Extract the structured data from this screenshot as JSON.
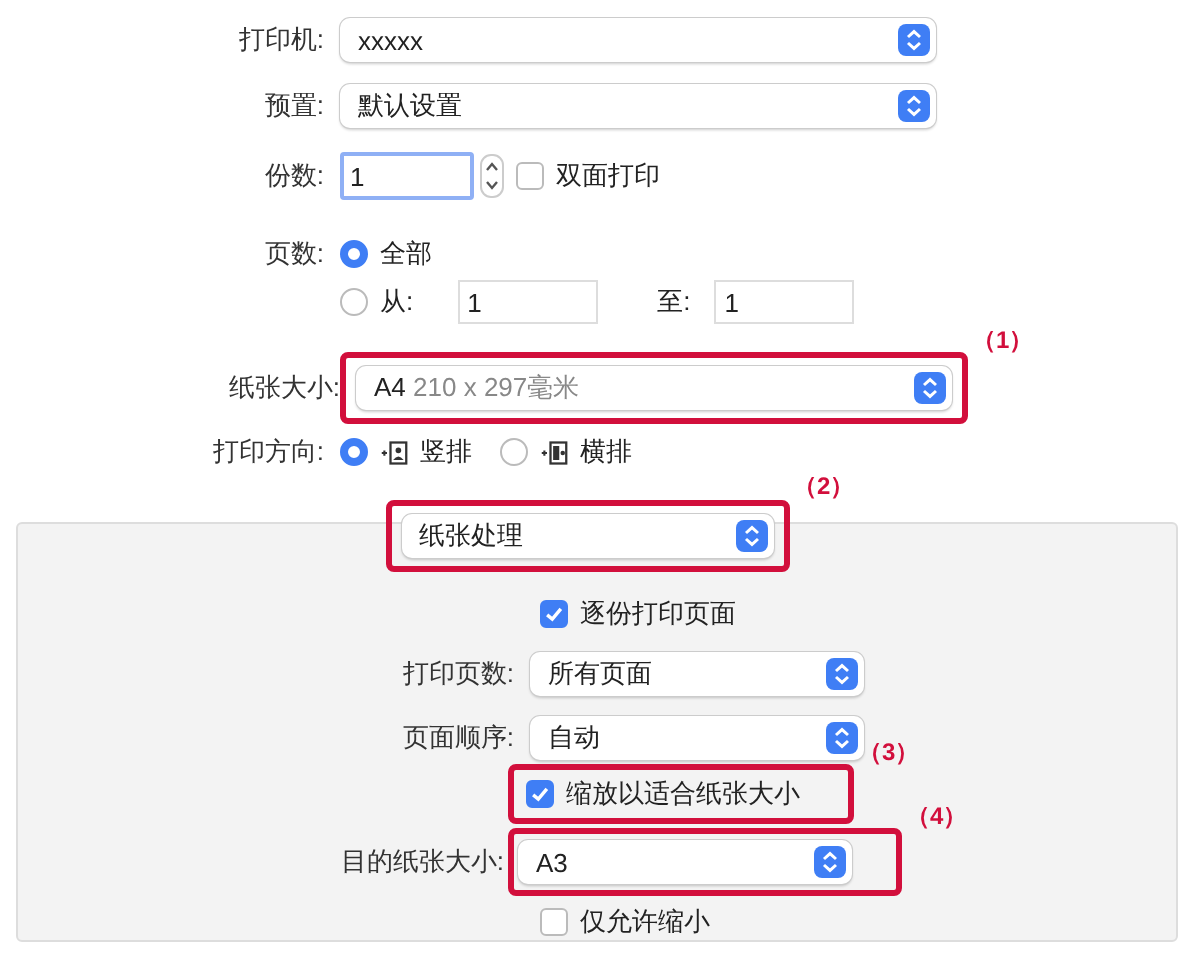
{
  "printer": {
    "label": "打印机:",
    "value": "xxxxx"
  },
  "preset": {
    "label": "预置:",
    "value": "默认设置"
  },
  "copies": {
    "label": "份数:",
    "value": "1",
    "duplex": {
      "label": "双面打印",
      "checked": false
    }
  },
  "pages": {
    "label": "页数:",
    "options": [
      {
        "label": "全部",
        "selected": true
      },
      {
        "label": "从:",
        "selected": false
      }
    ],
    "from": "1",
    "to_label": "至:",
    "to": "1"
  },
  "paper_size": {
    "label": "纸张大小:",
    "value": "A4",
    "detail": "210 x 297毫米",
    "callout": "（1）"
  },
  "orientation": {
    "label": "打印方向:",
    "options": [
      {
        "label": "竖排",
        "selected": true,
        "kind": "portrait"
      },
      {
        "label": "横排",
        "selected": false,
        "kind": "landscape"
      }
    ]
  },
  "section": {
    "value": "纸张处理",
    "callout": "（2）"
  },
  "panel": {
    "collate": {
      "label": "逐份打印页面",
      "checked": true
    },
    "pages_to_print": {
      "label": "打印页数:",
      "value": "所有页面"
    },
    "page_order": {
      "label": "页面顺序:",
      "value": "自动"
    },
    "scale": {
      "label": "缩放以适合纸张大小",
      "checked": true,
      "callout": "（3）"
    },
    "dest_size": {
      "label": "目的纸张大小:",
      "value": "A3",
      "callout": "（4）"
    },
    "reduce_only": {
      "label": "仅允许缩小",
      "checked": false
    }
  }
}
